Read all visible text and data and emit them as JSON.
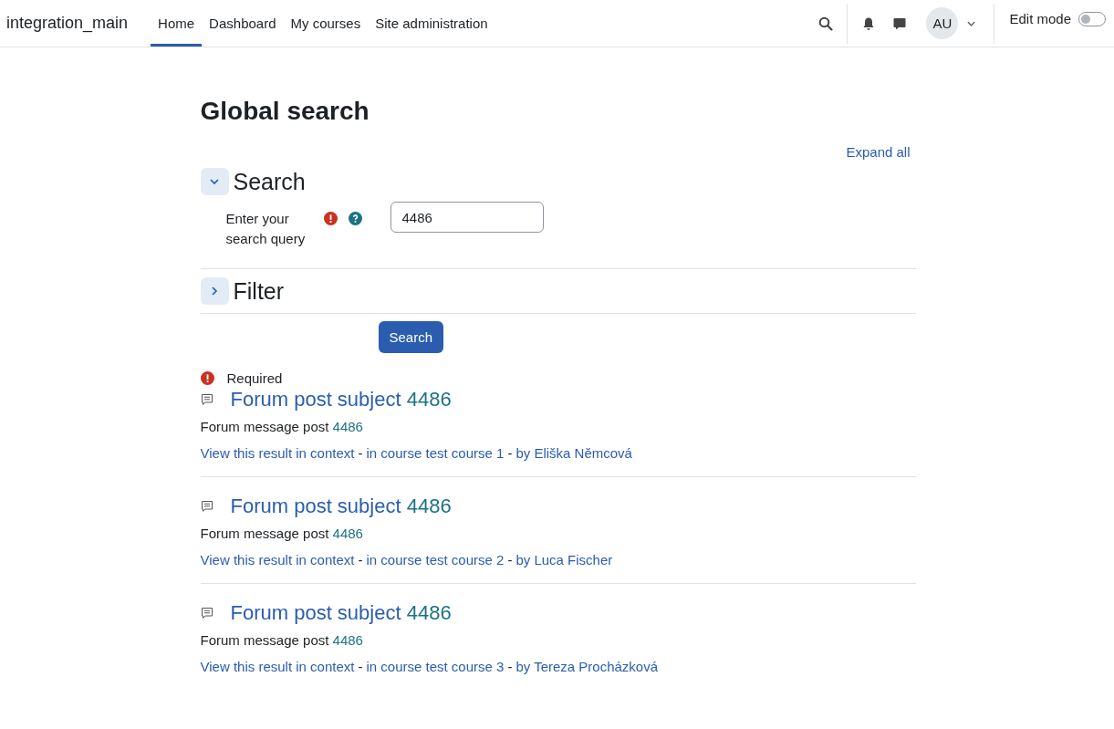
{
  "navbar": {
    "site_name": "integration_main",
    "nav_items": [
      {
        "label": "Home",
        "selected": true
      },
      {
        "label": "Dashboard",
        "selected": false
      },
      {
        "label": "My courses",
        "selected": false
      },
      {
        "label": "Site administration",
        "selected": false
      }
    ],
    "avatar": "AU",
    "edit_mode": {
      "label": "Edit mode",
      "on": false
    }
  },
  "page_title": "Global search",
  "expand_all": "Expand all",
  "sections": [
    {
      "title": "Search",
      "expanded": true
    },
    {
      "title": "Filter",
      "expanded": false
    }
  ],
  "query_field": {
    "label": "Enter your search query",
    "value": "4486"
  },
  "search_button": "Search",
  "required_note": "Required",
  "results": [
    {
      "title": "Forum post subject",
      "title_highlight": "4486",
      "content": "Forum message post",
      "content_highlight": "4486",
      "context_link": "View this result in context",
      "separator_1": "-",
      "course_link": "in course test course 1",
      "separator_2": "-",
      "author_link": "by Eliška Němcová"
    },
    {
      "title": "Forum post subject",
      "title_highlight": "4486",
      "content": "Forum message post",
      "content_highlight": "4486",
      "context_link": "View this result in context",
      "separator_1": "-",
      "course_link": "in course test course 2",
      "separator_2": "-",
      "author_link": "by Luca Fischer"
    },
    {
      "title": "Forum post subject",
      "title_highlight": "4486",
      "content": "Forum message post",
      "content_highlight": "4486",
      "context_link": "View this result in context",
      "separator_1": "-",
      "course_link": "in course test course 3",
      "separator_2": "-",
      "author_link": "by Tereza Procházková"
    }
  ]
}
